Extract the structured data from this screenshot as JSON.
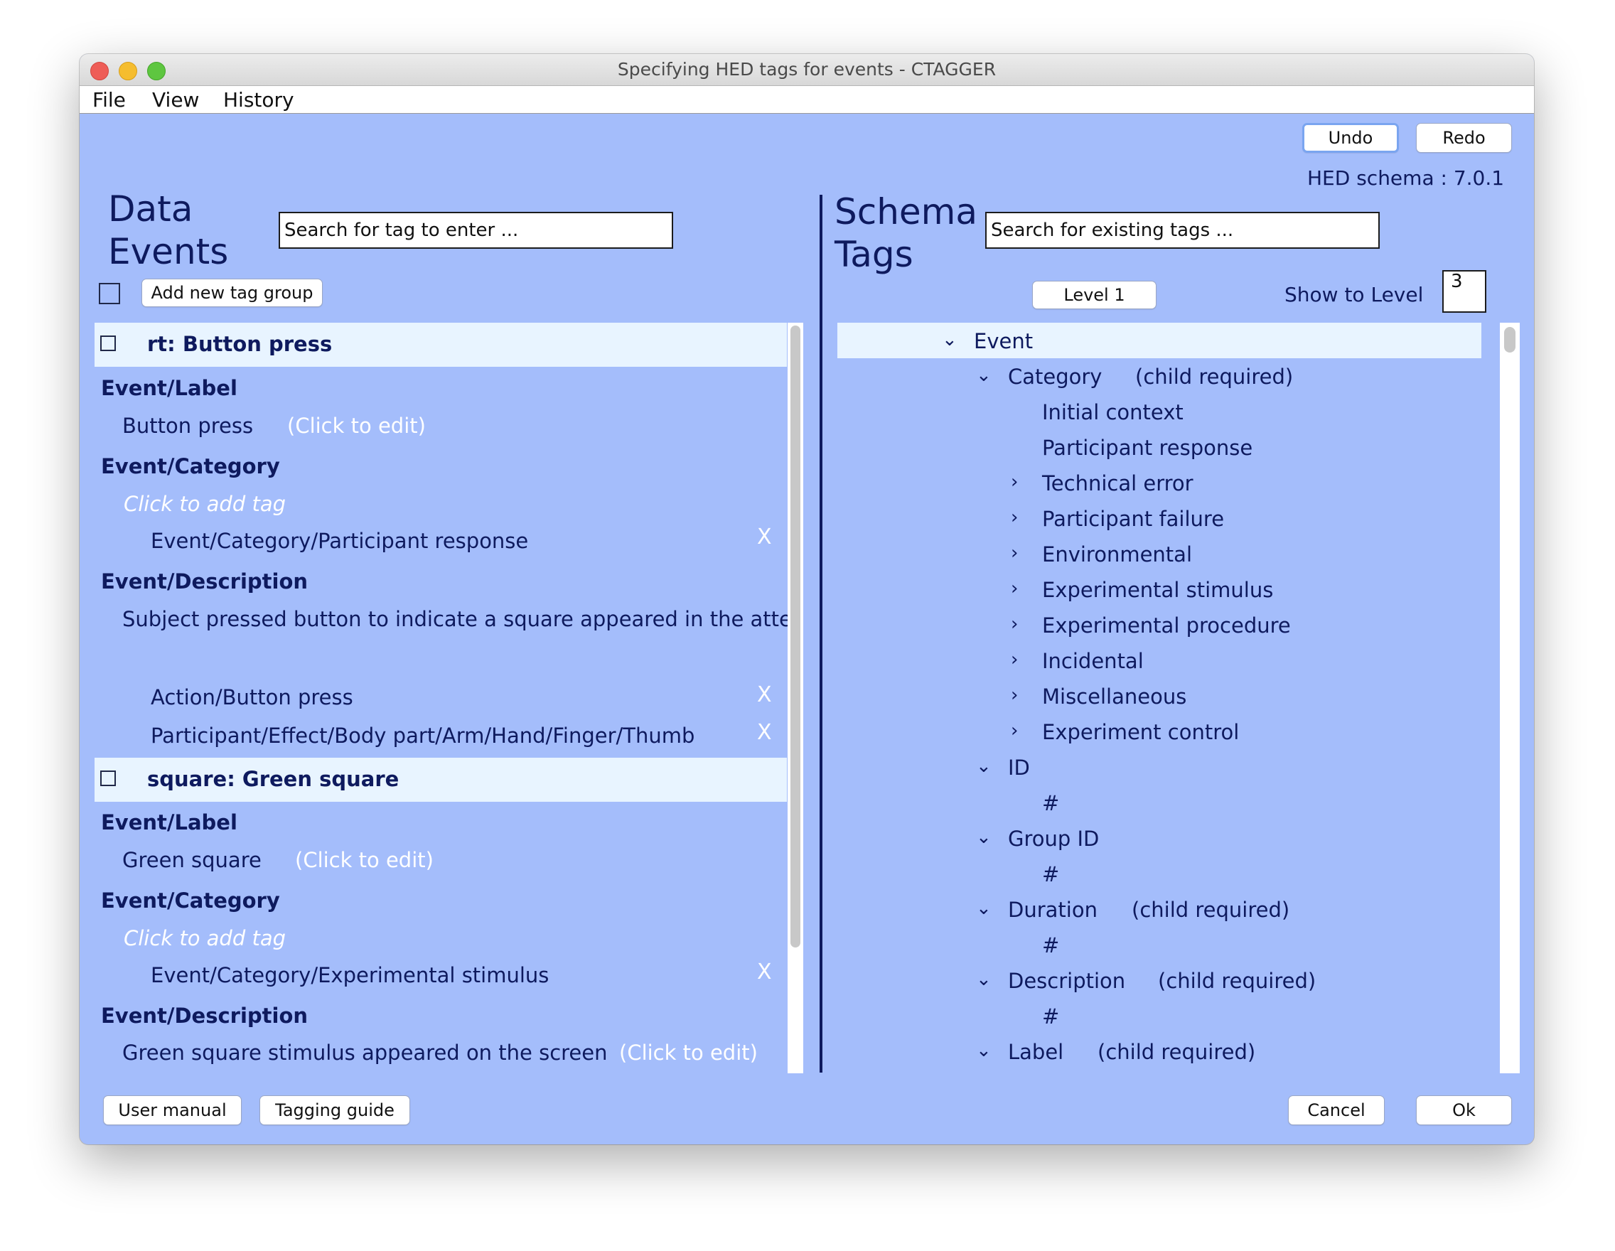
{
  "window": {
    "title": "Specifying HED tags for events - CTAGGER"
  },
  "menu": {
    "file": "File",
    "view": "View",
    "history": "History"
  },
  "toolbar": {
    "undo": "Undo",
    "redo": "Redo",
    "schema_version": "HED schema : 7.0.1"
  },
  "left": {
    "heading_line1": "Data",
    "heading_line2": "Events",
    "search_placeholder": "Search for tag to enter ...",
    "add_group_label": "Add new tag group",
    "events": [
      {
        "header": "rt: Button press",
        "label_section": "Event/Label",
        "label_value": "Button press",
        "label_edit_hint": "(Click to edit)",
        "category_section": "Event/Category",
        "category_add_hint": "Click to add tag",
        "category_tag": "Event/Category/Participant response",
        "description_section": "Event/Description",
        "description_value": "Subject pressed button to indicate a square appeared in the atten",
        "other_tags": [
          "Action/Button press",
          "Participant/Effect/Body part/Arm/Hand/Finger/Thumb"
        ]
      },
      {
        "header": "square: Green square",
        "label_section": "Event/Label",
        "label_value": "Green square",
        "label_edit_hint": "(Click to edit)",
        "category_section": "Event/Category",
        "category_add_hint": "Click to add tag",
        "category_tag": "Event/Category/Experimental stimulus",
        "description_section": "Event/Description",
        "description_value": "Green square stimulus appeared on the screen",
        "description_edit_hint": "(Click to edit)"
      }
    ],
    "remove_glyph": "X"
  },
  "right": {
    "heading_line1": "Schema",
    "heading_line2": "Tags",
    "search_placeholder": "Search for existing tags ...",
    "level_button": "Level 1",
    "show_to_level_label": "Show to Level",
    "show_to_level_value": "3",
    "tree": {
      "root": "Event",
      "category": "Category",
      "child_required": "(child required)",
      "category_children": [
        "Initial context",
        "Participant response",
        "Technical error",
        "Participant failure",
        "Environmental",
        "Experimental stimulus",
        "Experimental procedure",
        "Incidental",
        "Miscellaneous",
        "Experiment control"
      ],
      "id": "ID",
      "group_id": "Group ID",
      "duration": "Duration",
      "description": "Description",
      "label": "Label",
      "placeholder": "#"
    }
  },
  "footer": {
    "user_manual": "User manual",
    "tagging_guide": "Tagging guide",
    "cancel": "Cancel",
    "ok": "Ok"
  },
  "icons": {
    "expanded": "chevron-down-icon",
    "collapsed": "chevron-right-icon",
    "remove": "remove-tag-icon"
  }
}
